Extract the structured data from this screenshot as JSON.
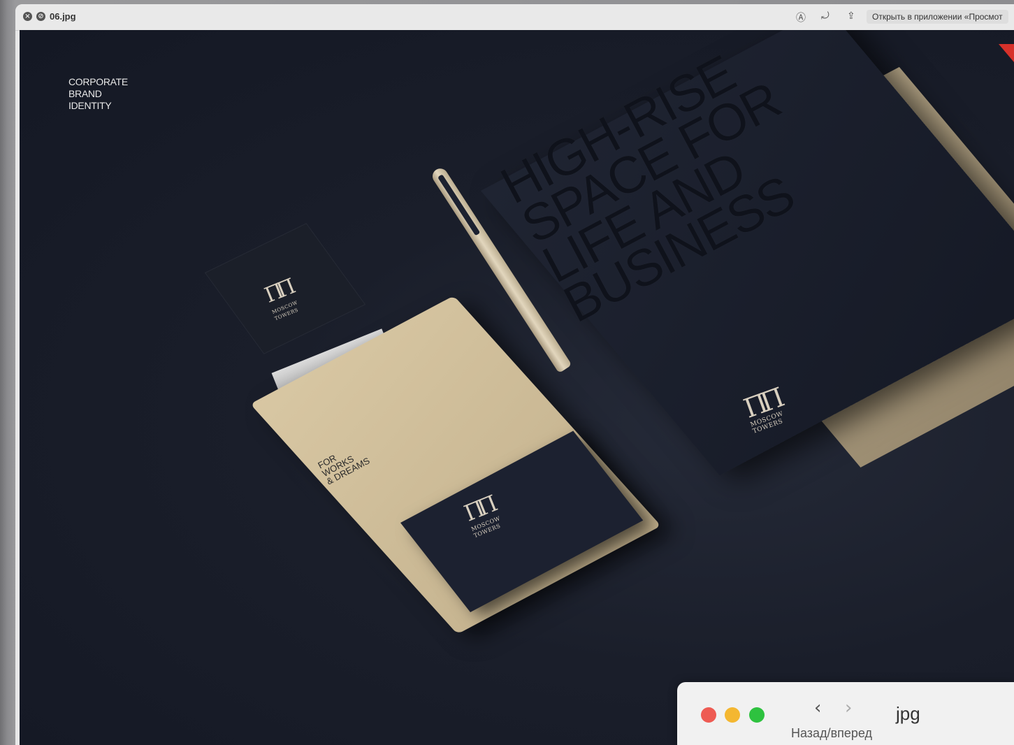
{
  "window": {
    "filename": "06.jpg",
    "open_in_app": "Открыть в приложении «Просмот"
  },
  "icons": {
    "close": "close-circle-icon",
    "block": "no-entry-icon",
    "markup": "markup-icon",
    "rotate": "rotate-icon",
    "share": "share-icon"
  },
  "image": {
    "caption": "CORPORATE\nBRAND\nIDENTITY",
    "headline": "HIGH-RISE\nSPACE FOR\nLIFE AND\nBUSINESS",
    "logo_name": "MOSCOW\nTOWERS",
    "notebook_text": "FOR\nWORKS\n& DREAMS",
    "pen_text": "MOSCOW TOWERS"
  },
  "mini_window": {
    "title": "jpg",
    "nav_label": "Назад/вперед",
    "traffic_colors": [
      "#ee5b53",
      "#f4b731",
      "#2ec23f"
    ]
  }
}
